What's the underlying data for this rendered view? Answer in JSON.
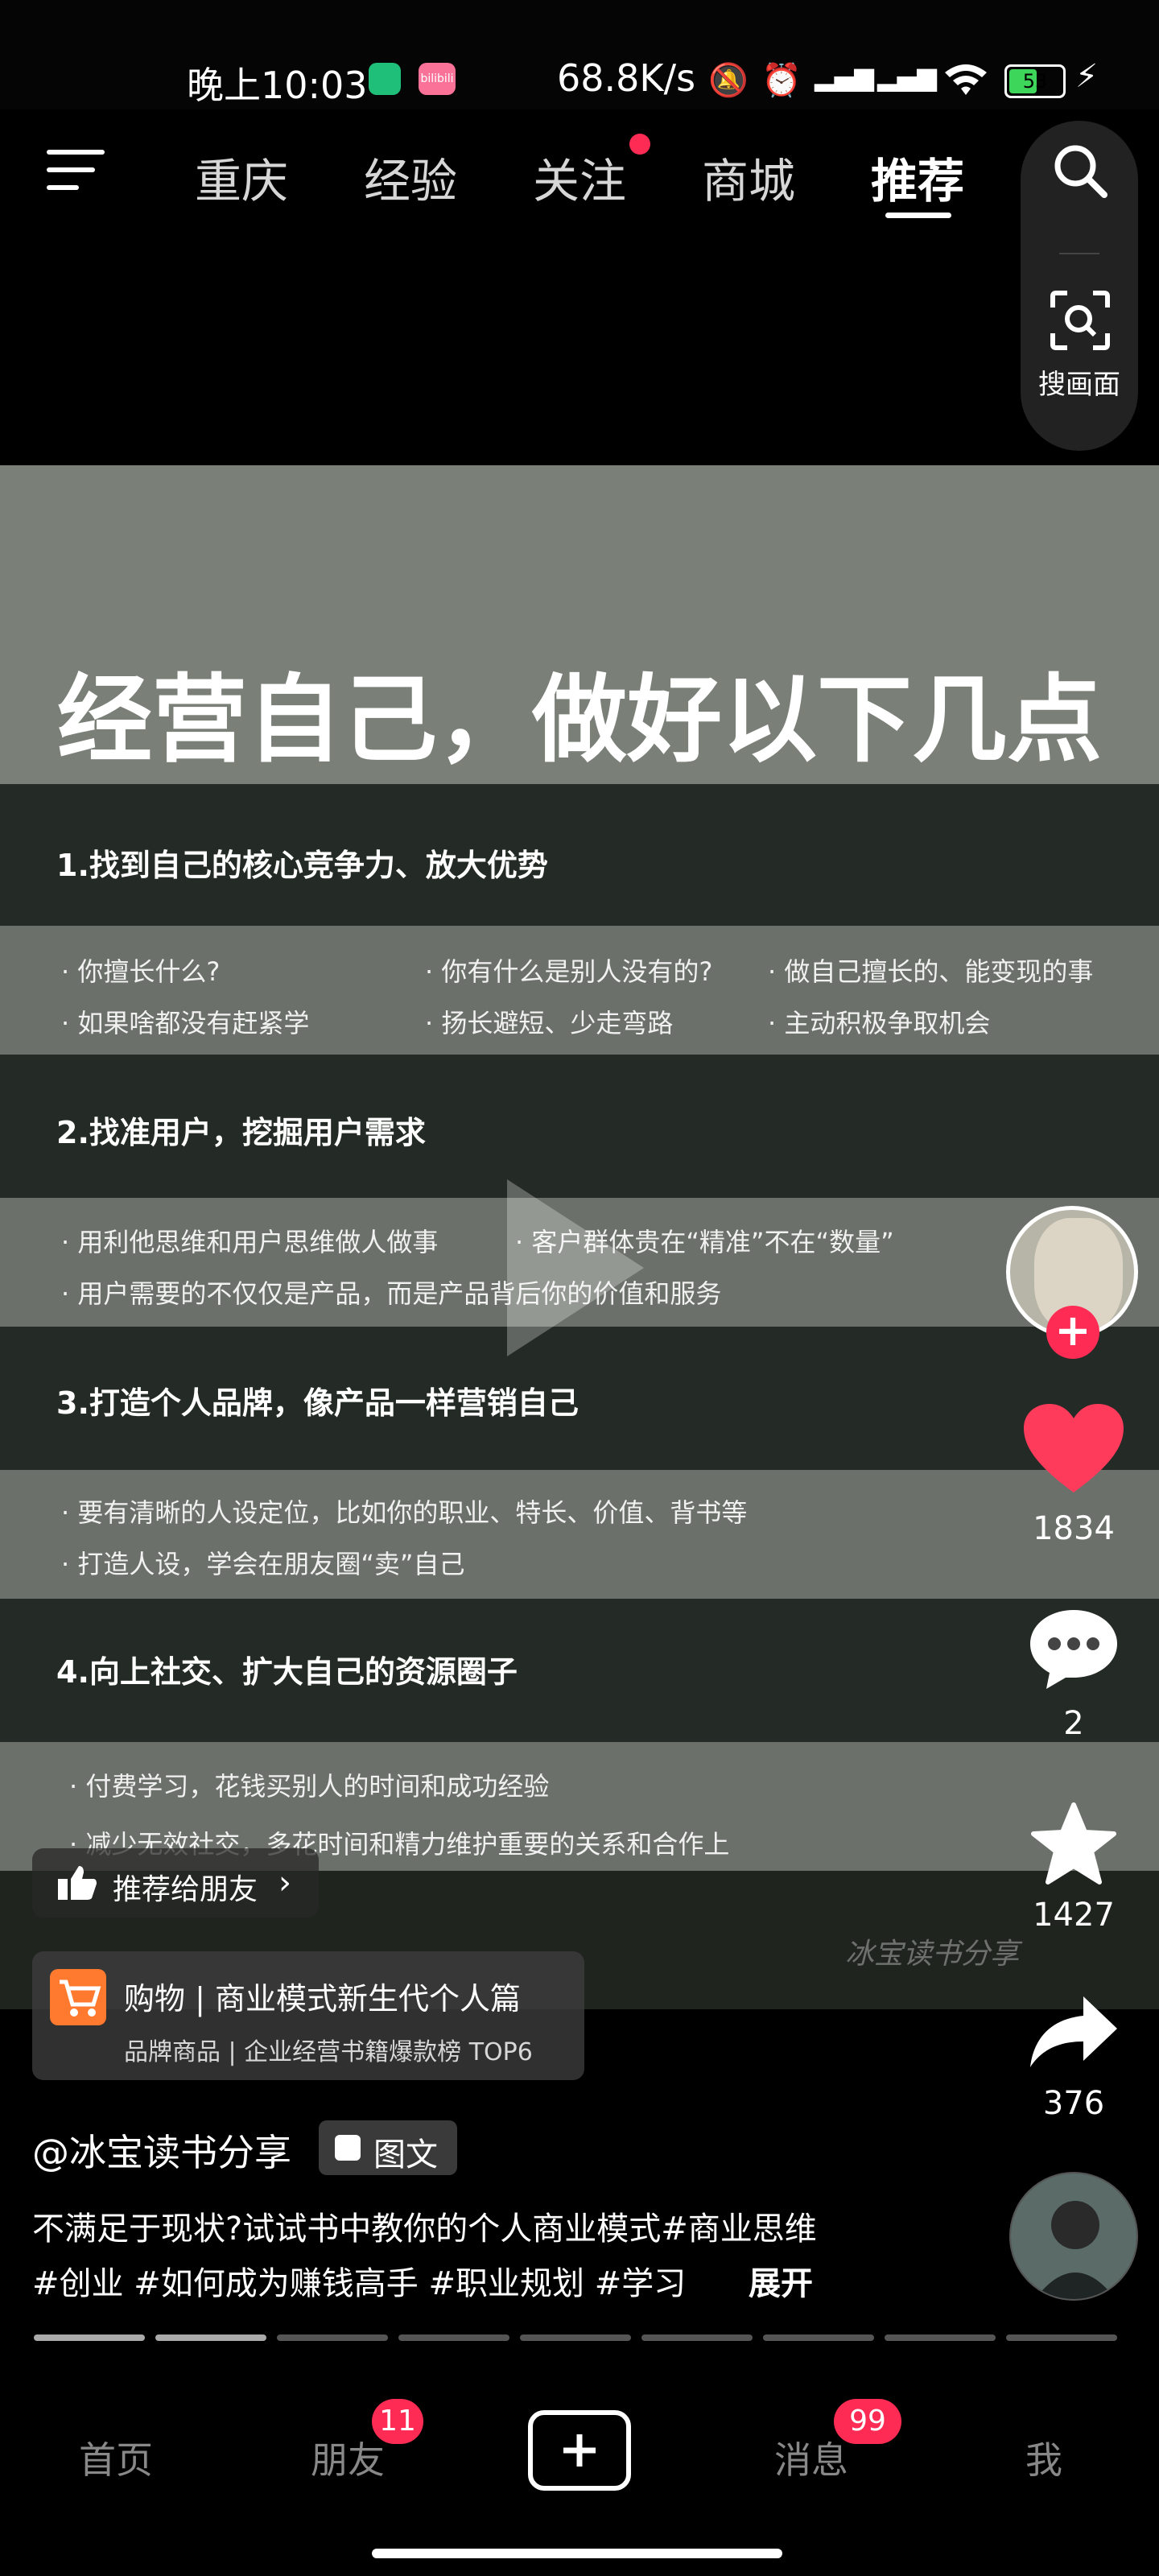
{
  "status_bar": {
    "time": "晚上10:03",
    "network_speed": "68.8K/s",
    "battery": "53",
    "bili_label": "bilibili"
  },
  "top_nav": {
    "tabs": [
      {
        "label": "重庆"
      },
      {
        "label": "经验"
      },
      {
        "label": "关注"
      },
      {
        "label": "商城"
      },
      {
        "label": "推荐"
      }
    ],
    "active_tab": "推荐",
    "scan_label": "搜画面"
  },
  "post": {
    "title": "经营自己，做好以下几点",
    "sections": [
      {
        "heading": "1.找到自己的核心竞争力、放大优势",
        "bullets": [
          "· 你擅长什么?",
          "· 你有什么是别人没有的?",
          "· 做自己擅长的、能变现的事",
          "· 如果啥都没有赶紧学",
          "· 扬长避短、少走弯路",
          "· 主动积极争取机会"
        ]
      },
      {
        "heading": "2.找准用户，挖掘用户需求",
        "bullets": [
          "· 用利他思维和用户思维做人做事",
          "· 客户群体贵在“精准”不在“数量”",
          "· 用户需要的不仅仅是产品，而是产品背后你的价值和服务"
        ]
      },
      {
        "heading": "3.打造个人品牌，像产品一样营销自己",
        "bullets": [
          "· 要有清晰的人设定位，比如你的职业、特长、价值、背书等",
          "· 打造人设，学会在朋友圈“卖”自己"
        ]
      },
      {
        "heading": "4.向上社交、扩大自己的资源圈子",
        "bullets": [
          "· 付费学习，花钱买别人的时间和成功经验",
          "· 减少无效社交，多花时间和精力维护重要的关系和合作上"
        ]
      }
    ],
    "watermark": "冰宝读书分享"
  },
  "actions": {
    "likes": "1834",
    "comments": "2",
    "favorites": "1427",
    "shares": "376",
    "follow_symbol": "+"
  },
  "overlay": {
    "recommend_label": "推荐给朋友",
    "shop_title": "购物 | 商业模式新生代个人篇",
    "shop_sub": "品牌商品 | 企业经营书籍爆款榜 TOP6",
    "author": "@冰宝读书分享",
    "post_type": "图文",
    "caption_line1": "不满足于现状?试试书中教你的个人商业模式#商业思维",
    "caption_line2": "#创业 #如何成为赚钱高手 #职业规划 #学习",
    "expand_label": "展开",
    "progress_total": 9,
    "progress_current": 2
  },
  "bottom_nav": {
    "items": [
      {
        "label": "首页"
      },
      {
        "label": "朋友"
      },
      {
        "label": "消息"
      },
      {
        "label": "我"
      }
    ],
    "friends_badge": "11",
    "messages_badge": "99",
    "colors": {
      "accent": "#fe2c55",
      "like": "#ff3b5c",
      "shop": "#ff7a2e"
    }
  }
}
